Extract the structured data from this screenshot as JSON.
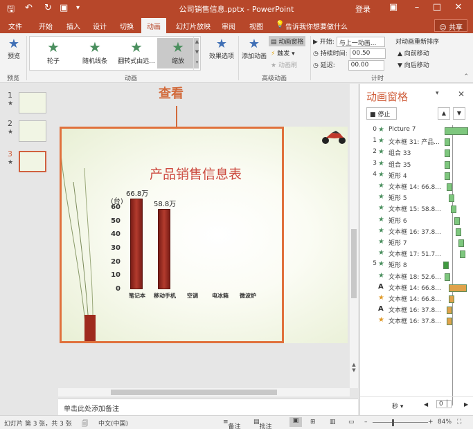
{
  "app": {
    "title": "公司销售信息.pptx - PowerPoint",
    "login": "登录",
    "share": "共享"
  },
  "tabs": [
    "文件",
    "开始",
    "插入",
    "设计",
    "切换",
    "动画",
    "幻灯片放映",
    "审阅",
    "视图"
  ],
  "active_tab": "动画",
  "tell_me": "告诉我你想要做什么",
  "ribbon": {
    "preview": "预览",
    "preview_group": "预览",
    "animation_group": "动画",
    "gallery": [
      "轮子",
      "随机线条",
      "翻转式由远...",
      "缩放"
    ],
    "effect_options": "效果选项",
    "add_animation": "添加动画",
    "animation_pane": "动画窗格",
    "trigger": "触发",
    "animation_painter": "动画刷",
    "advanced_group": "高级动画",
    "start_label": "开始:",
    "start_value": "与上一动画...",
    "duration_label": "持续时间:",
    "duration_value": "00.50",
    "delay_label": "延迟:",
    "delay_value": "00.00",
    "reorder_title": "对动画重新排序",
    "move_earlier": "向前移动",
    "move_later": "向后移动",
    "timing_group": "计时"
  },
  "thumbnails": [
    {
      "num": "1",
      "star": "★"
    },
    {
      "num": "2",
      "star": "★"
    },
    {
      "num": "3",
      "star": "★"
    }
  ],
  "annotation": "查看",
  "slide": {
    "title": "产品销售信息表",
    "unit": "(台)"
  },
  "chart_data": {
    "type": "bar",
    "title": "产品销售信息表",
    "ylabel": "(台)",
    "categories": [
      "笔记本",
      "移动手机",
      "空调",
      "电冰箱",
      "微波炉"
    ],
    "values": [
      66.8,
      58.8,
      null,
      null,
      null
    ],
    "data_labels": [
      "66.8万",
      "58.8万"
    ],
    "yticks": [
      "0",
      "10",
      "20",
      "30",
      "40",
      "50",
      "60"
    ],
    "ylim": [
      0,
      70
    ]
  },
  "notes_placeholder": "单击此处添加备注",
  "animation_pane": {
    "title": "动画窗格",
    "stop": "停止",
    "seconds": "秒",
    "scale_start": "0",
    "items": [
      {
        "num": "0",
        "icon": "star",
        "label": "Picture 7",
        "color": "#7ec77e"
      },
      {
        "num": "1",
        "icon": "star",
        "label": "文本框 31: 产品...",
        "color": "#7ec77e"
      },
      {
        "num": "2",
        "icon": "star",
        "label": "组合 33",
        "color": "#7ec77e"
      },
      {
        "num": "3",
        "icon": "star",
        "label": "组合 35",
        "color": "#7ec77e"
      },
      {
        "num": "4",
        "icon": "star",
        "label": "矩形 4",
        "color": "#7ec77e"
      },
      {
        "num": "",
        "icon": "star",
        "label": "文本框 14: 66.8...",
        "color": "#7ec77e"
      },
      {
        "num": "",
        "icon": "star",
        "label": "矩形 5",
        "color": "#7ec77e"
      },
      {
        "num": "",
        "icon": "star",
        "label": "文本框 15: 58.8...",
        "color": "#7ec77e"
      },
      {
        "num": "",
        "icon": "star",
        "label": "矩形 6",
        "color": "#7ec77e"
      },
      {
        "num": "",
        "icon": "star",
        "label": "文本框 16: 37.8...",
        "color": "#7ec77e"
      },
      {
        "num": "",
        "icon": "star",
        "label": "矩形 7",
        "color": "#7ec77e"
      },
      {
        "num": "",
        "icon": "star",
        "label": "文本框 17: 51.7...",
        "color": "#7ec77e"
      },
      {
        "num": "5",
        "icon": "star",
        "label": "矩形 8",
        "color": "#3f9a3f"
      },
      {
        "num": "",
        "icon": "star",
        "label": "文本框 18: 52.6...",
        "color": "#7ec77e"
      },
      {
        "num": "",
        "icon": "text-a",
        "label": "文本框 14: 66.8...",
        "color": "#e0a24a"
      },
      {
        "num": "",
        "icon": "star-orange",
        "label": "文本框 14: 66.8...",
        "color": "#e0a24a"
      },
      {
        "num": "",
        "icon": "text-a",
        "label": "文本框 16: 37.8...",
        "color": "#e0a24a"
      },
      {
        "num": "",
        "icon": "star-orange",
        "label": "文本框 16: 37.8...",
        "color": "#e0a24a"
      }
    ]
  },
  "status": {
    "slide_info": "幻灯片 第 3 张，共 3 张",
    "language": "中文(中国)",
    "notes": "备注",
    "comments": "批注",
    "zoom": "84%"
  }
}
